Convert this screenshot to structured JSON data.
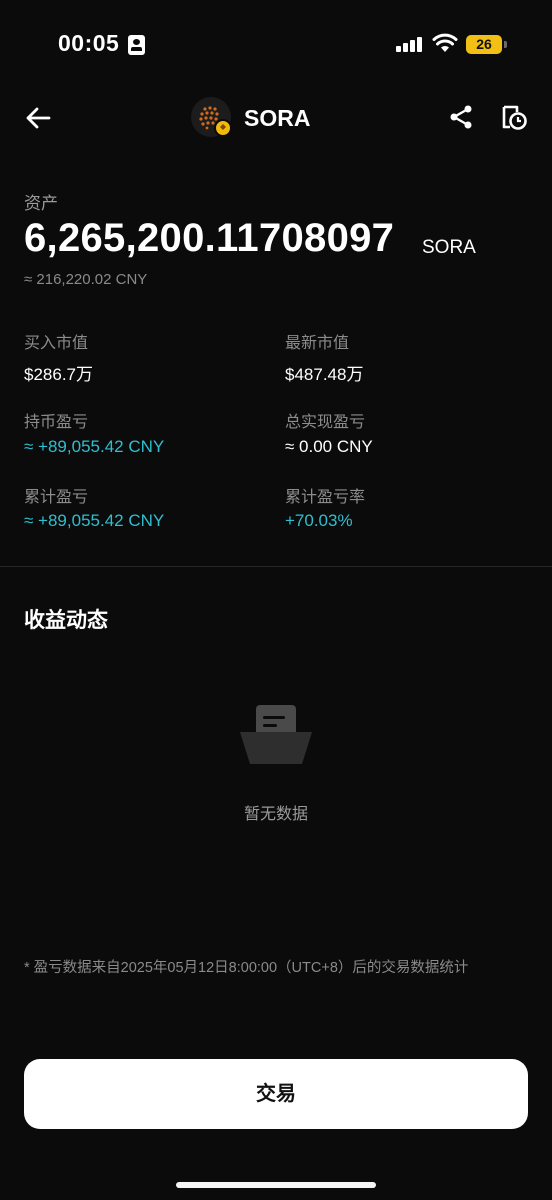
{
  "status_bar": {
    "time": "00:05",
    "battery": "26"
  },
  "header": {
    "title": "SORA",
    "icons": [
      "back-arrow-icon",
      "share-icon",
      "history-icon"
    ]
  },
  "asset": {
    "label": "资产",
    "value": "6,265,200.11708097",
    "unit": "SORA",
    "fiat": "≈ 216,220.02 CNY"
  },
  "stats": [
    {
      "label": "买入市值",
      "value": "$286.7万",
      "color": "#ffffff"
    },
    {
      "label": "最新市值",
      "value": "$487.48万",
      "color": "#ffffff"
    },
    {
      "label": "持币盈亏",
      "value": "≈ +89,055.42 CNY",
      "color": "#2ebfd0"
    },
    {
      "label": "总实现盈亏",
      "value": "≈ 0.00 CNY",
      "color": "#ffffff"
    },
    {
      "label": "累计盈亏",
      "value": "≈ +89,055.42 CNY",
      "color": "#2ebfd0"
    },
    {
      "label": "累计盈亏率",
      "value": "+70.03%",
      "color": "#2ebfd0"
    }
  ],
  "earnings": {
    "title": "收益动态",
    "empty_text": "暂无数据"
  },
  "footnote": "* 盈亏数据来自2025年05月12日8:00:00（UTC+8）后的交易数据统计",
  "trade_button": "交易",
  "colors": {
    "background": "#0b0b0b",
    "positive": "#2ebfd0",
    "battery": "#f2c014",
    "coin_badge": "#f0b90b"
  }
}
